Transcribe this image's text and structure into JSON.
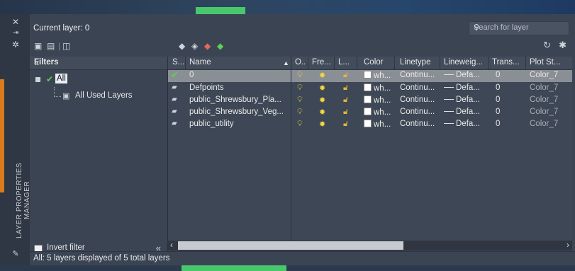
{
  "header": {
    "current_layer": "Current layer: 0",
    "search_placeholder": "Search for layer"
  },
  "palette_title": "LAYER PROPERTIES MANAGER",
  "filters": {
    "title": "Filters",
    "tree": [
      {
        "label": "All",
        "selected": true
      },
      {
        "label": "All Used Layers",
        "selected": false
      }
    ],
    "invert_label": "Invert filter"
  },
  "columns": [
    "S...",
    "Name",
    "O...",
    "Fre...",
    "L...",
    "Color",
    "Linetype",
    "Lineweig...",
    "Trans...",
    "Plot St..."
  ],
  "layers": [
    {
      "name": "0",
      "color": "wh...",
      "linetype": "Continu...",
      "lineweight": "Defa...",
      "transparency": "0",
      "plot_style": "Color_7",
      "current": true
    },
    {
      "name": "Defpoints",
      "color": "wh...",
      "linetype": "Continu...",
      "lineweight": "Defa...",
      "transparency": "0",
      "plot_style": "Color_7",
      "current": false
    },
    {
      "name": "public_Shrewsbury_Pla...",
      "color": "wh...",
      "linetype": "Continu...",
      "lineweight": "Defa...",
      "transparency": "0",
      "plot_style": "Color_7",
      "current": false
    },
    {
      "name": "public_Shrewsbury_Veg...",
      "color": "wh...",
      "linetype": "Continu...",
      "lineweight": "Defa...",
      "transparency": "0",
      "plot_style": "Color_7",
      "current": false
    },
    {
      "name": "public_utility",
      "color": "wh...",
      "linetype": "Continu...",
      "lineweight": "Defa...",
      "transparency": "0",
      "plot_style": "Color_7",
      "current": false
    }
  ],
  "status": "All: 5 layers displayed of 5 total layers",
  "icons": {
    "close": "close-icon",
    "pin": "auto-hide-icon",
    "props": "properties-icon",
    "new_filter": "new-property-filter-icon",
    "new_group": "new-group-filter-icon",
    "states": "layer-states-icon",
    "new_layer": "new-layer-icon",
    "new_vp_frozen": "new-layer-vp-frozen-icon",
    "delete_layer": "delete-layer-icon",
    "set_current": "set-current-icon",
    "refresh": "refresh-icon",
    "settings": "settings-icon"
  },
  "colors": {
    "accent_green": "#48c86a",
    "palette_orange": "#d97a1b",
    "selected_row": "#8a8f96"
  }
}
